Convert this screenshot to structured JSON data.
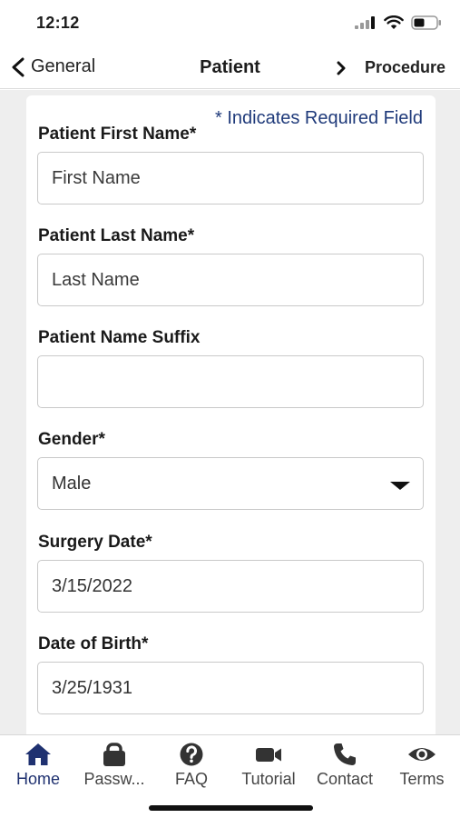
{
  "status": {
    "time": "12:12"
  },
  "nav": {
    "back_label": "General",
    "title": "Patient",
    "next_label": "Procedure"
  },
  "form": {
    "required_note": "* Indicates Required Field",
    "first_name": {
      "label": "Patient First Name*",
      "placeholder": "First Name"
    },
    "last_name": {
      "label": "Patient Last Name*",
      "placeholder": "Last Name"
    },
    "suffix": {
      "label": "Patient Name Suffix",
      "value": ""
    },
    "gender": {
      "label": "Gender*",
      "value": "Male"
    },
    "surgery_date": {
      "label": "Surgery Date*",
      "value": "3/15/2022"
    },
    "dob": {
      "label": "Date of Birth*",
      "value": "3/25/1931"
    }
  },
  "tabs": [
    {
      "label": "Home",
      "icon": "home-icon"
    },
    {
      "label": "Passw...",
      "icon": "lock-icon"
    },
    {
      "label": "FAQ",
      "icon": "help-icon"
    },
    {
      "label": "Tutorial",
      "icon": "video-icon"
    },
    {
      "label": "Contact",
      "icon": "phone-icon"
    },
    {
      "label": "Terms",
      "icon": "eye-icon"
    }
  ],
  "colors": {
    "accent": "#1f3170",
    "required_note": "#1f3a7a",
    "background": "#eeeeee"
  }
}
